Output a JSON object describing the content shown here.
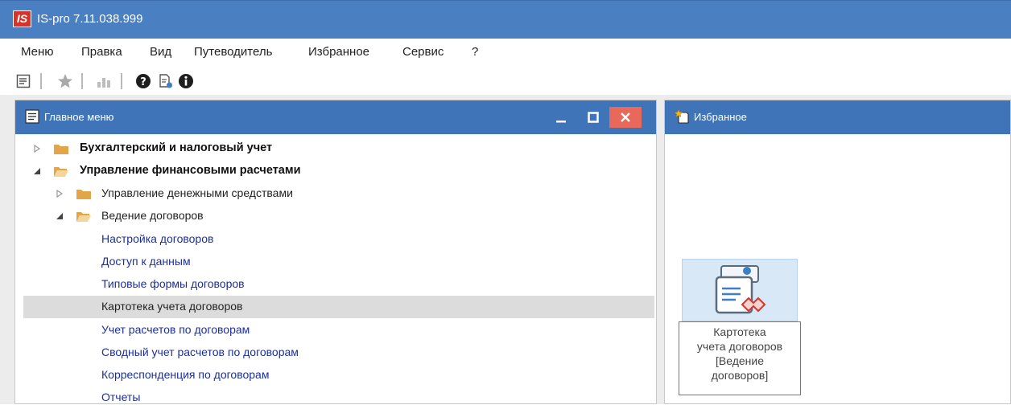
{
  "app": {
    "logo": "IS",
    "title": "IS-pro 7.11.038.999"
  },
  "menubar": {
    "items": [
      "Меню",
      "Правка",
      "Вид",
      "Путеводитель",
      "Избранное",
      "Сервис",
      "?"
    ]
  },
  "toolbar": {
    "icons": [
      "list-icon",
      "star-icon",
      "chart-icon",
      "help-icon",
      "document-settings-icon",
      "info-icon"
    ]
  },
  "main_menu": {
    "title": "Главное меню",
    "tree": [
      {
        "label": "Бухгалтерский и налоговый учет",
        "style": "bold",
        "expander": "collapsed",
        "folder": "closed"
      },
      {
        "label": "Управление финансовыми расчетами",
        "style": "bold",
        "expander": "expanded",
        "folder": "open"
      },
      {
        "label": "Управление денежными средствами",
        "style": "normal",
        "expander": "collapsed",
        "folder": "closed"
      },
      {
        "label": "Ведение договоров",
        "style": "normal",
        "expander": "expanded",
        "folder": "open"
      },
      {
        "label": "Настройка договоров",
        "style": "link"
      },
      {
        "label": "Доступ к данным",
        "style": "link"
      },
      {
        "label": "Типовые формы договоров",
        "style": "link"
      },
      {
        "label": "Картотека учета договоров",
        "style": "selected"
      },
      {
        "label": "Учет расчетов по договорам",
        "style": "link"
      },
      {
        "label": "Сводный учет расчетов по договорам",
        "style": "link"
      },
      {
        "label": "Корреспонденция по договорам",
        "style": "link"
      },
      {
        "label": "Отчеты",
        "style": "link"
      }
    ]
  },
  "favorites": {
    "title": "Избранное",
    "tile_tooltip": [
      "Картотека",
      "учета договоров",
      "[Ведение",
      "договоров]"
    ]
  },
  "colors": {
    "titlebar": "#4a7fc1",
    "panel_header": "#3f75b8",
    "close_button": "#e8685a",
    "link_text": "#1c2f9c",
    "selected_row": "#dcdcdc",
    "folder": "#e2a54a"
  }
}
